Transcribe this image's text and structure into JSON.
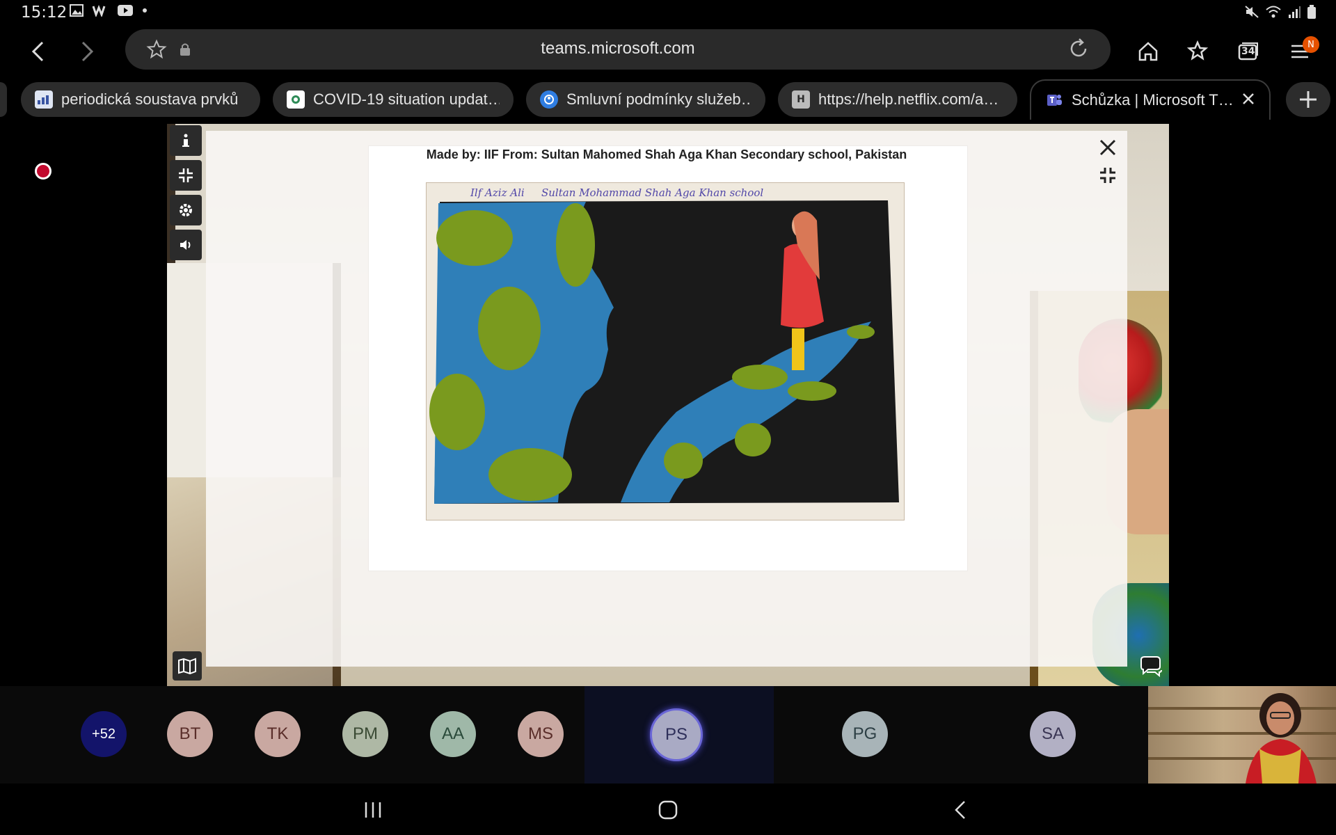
{
  "status": {
    "time": "15:12"
  },
  "browser": {
    "url": "teams.microsoft.com",
    "tab_count": "34",
    "profile_initial": "N",
    "tabs": [
      {
        "label": "periodická soustava prvků",
        "favicon": "chart-favicon"
      },
      {
        "label": "COVID-19 situation updat…",
        "favicon": "covid-favicon"
      },
      {
        "label": "Smluvní podmínky služeb…",
        "favicon": "service-favicon"
      },
      {
        "label": "https://help.netflix.com/a…",
        "favicon": "H"
      },
      {
        "label": "Schůzka | Microsoft T…",
        "favicon": "teams-favicon"
      }
    ]
  },
  "modal": {
    "caption": "Made by: IIF From: Sultan Mahomed Shah Aga Khan Secondary school, Pakistan",
    "artwork_signature_left": "Ilf Aziz Ali",
    "artwork_signature_right": "Sultan Mohammad Shah Aga Khan school"
  },
  "participants": {
    "overflow": "+52",
    "items": [
      {
        "initials": "BT",
        "color": "#c9a8a1",
        "text_color": "#5a2e2a"
      },
      {
        "initials": "TK",
        "color": "#c9a8a1",
        "text_color": "#5a2e2a"
      },
      {
        "initials": "PM",
        "color": "#aeb8a5",
        "text_color": "#3a4a34"
      },
      {
        "initials": "AA",
        "color": "#9fb8a8",
        "text_color": "#2a4a3a"
      },
      {
        "initials": "MS",
        "color": "#c9a8a1",
        "text_color": "#5a2e2a"
      },
      {
        "initials": "PS",
        "color": "#a9aac4",
        "text_color": "#2e2f5a"
      },
      {
        "initials": "PG",
        "color": "#a8b4b8",
        "text_color": "#2c3e44"
      },
      {
        "initials": "SA",
        "color": "#b2b0c4",
        "text_color": "#3a3654"
      }
    ]
  }
}
